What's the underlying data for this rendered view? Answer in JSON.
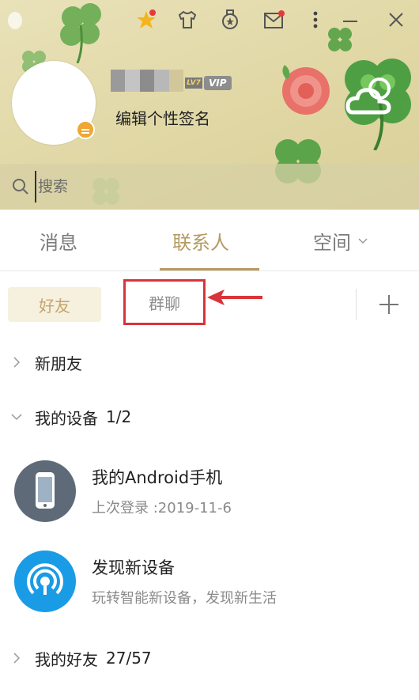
{
  "header": {
    "signature": "编辑个性签名",
    "level_badge": "LV7",
    "vip_label": "VIP"
  },
  "search": {
    "placeholder": "搜索"
  },
  "main_tabs": [
    {
      "label": "消息"
    },
    {
      "label": "联系人"
    },
    {
      "label": "空间"
    }
  ],
  "sub_tabs": {
    "friends": "好友",
    "groups": "群聊",
    "add": "+"
  },
  "list": {
    "new_friends": "新朋友",
    "my_devices": {
      "label": "我的设备",
      "count": "1/2"
    },
    "devices": [
      {
        "title": "我的Android手机",
        "subtitle": "上次登录 :2019-11-6"
      },
      {
        "title": "发现新设备",
        "subtitle": "玩转智能新设备，发现新生活"
      }
    ],
    "my_friends": {
      "label": "我的好友",
      "count": "27/57"
    }
  },
  "colors": {
    "accent": "#b59a62",
    "annotation_red": "#d9343a",
    "phone_icon_bg": "#5f6a78",
    "discover_icon_bg": "#1a9be6"
  }
}
